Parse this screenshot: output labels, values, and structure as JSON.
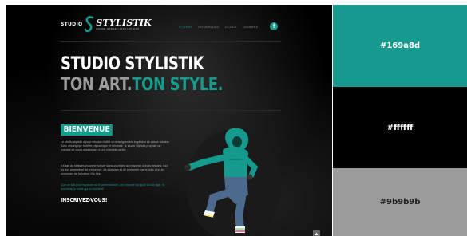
{
  "site": {
    "logo": {
      "studio": "STUDIO",
      "name": "STYLISTIK",
      "tagline": "DANSE STREET-JAZZ HIP-HOP"
    },
    "nav": {
      "items": [
        {
          "label": "STUDIO"
        },
        {
          "label": "NOUVELLES"
        },
        {
          "label": "ECOLE"
        },
        {
          "label": "JOINDRE"
        }
      ],
      "facebook_label": "f"
    },
    "hero": {
      "line1": "STUDIO STYLISTIK",
      "line2_a": "TON ART.",
      "line2_b": "TON STYLE."
    },
    "welcome": {
      "heading": "BIENVENUE",
      "paragraph1": "Le studio stylistik a pour mission d'offrir un enseignement supérieur de danse urbaine. Avec une équipe fortifiée, dynamique et dévouée, le studio Stylistik propose un éventail de cours s'adressant à une clientèle variée.",
      "paragraph2": "Il s'agit de stylistes pouvant évoluer dans un milieu qui respecte à leurs besoins, tout en leur permettant de s'exprimer, de s'amuser et de performer par le biais d'un art provenant de la culture Hip Hop.",
      "paragraph3": "Que ce soit pour te placer ou te perfectionner, peu importe ton goût ou ton âge, tu trouveras le cours qui te convient!",
      "cta": "INSCRIVEZ-VOUS!"
    },
    "scroll_top_label": "▲"
  },
  "swatches": [
    {
      "label": "#169a8d",
      "color": "#169a8d"
    },
    {
      "label": "#ffffff",
      "color": "#000000"
    },
    {
      "label": "#9b9b9b",
      "color": "#9b9b9b"
    }
  ],
  "colors": {
    "accent": "#169a8d",
    "gray": "#9b9b9b",
    "white": "#ffffff",
    "black": "#000000"
  }
}
